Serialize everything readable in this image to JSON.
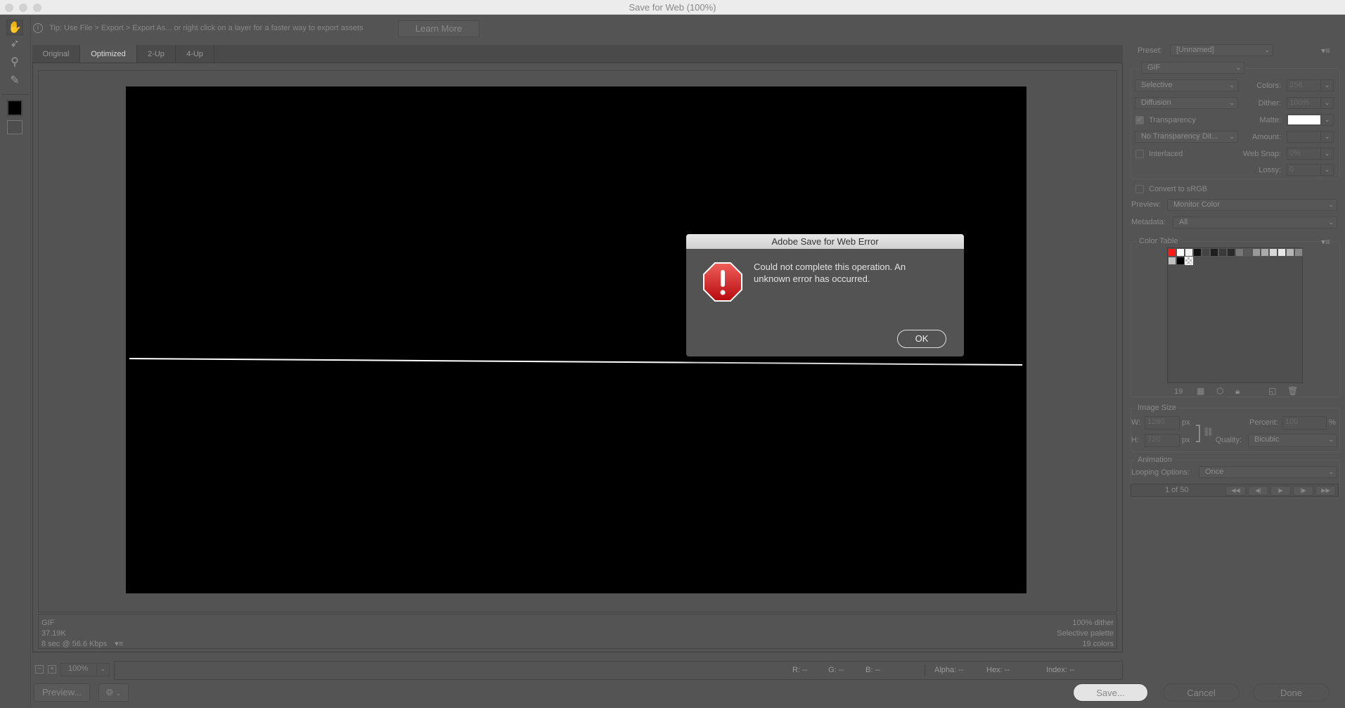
{
  "window": {
    "title": "Save for Web (100%)"
  },
  "tip": {
    "text": "Tip: Use File > Export > Export As...  or right click on a layer for a faster way to export assets",
    "learn_more": "Learn More"
  },
  "tabs": [
    {
      "label": "Original"
    },
    {
      "label": "Optimized",
      "active": true
    },
    {
      "label": "2-Up"
    },
    {
      "label": "4-Up"
    }
  ],
  "info_left": {
    "format": "GIF",
    "size": "37.19K",
    "time": "8 sec @ 56.6 Kbps"
  },
  "info_right": {
    "dither": "100% dither",
    "palette": "Selective palette",
    "colors": "19 colors"
  },
  "zoom": {
    "value": "100%"
  },
  "status": {
    "r": "R: --",
    "g": "G: --",
    "b": "B: --",
    "alpha": "Alpha: --",
    "hex": "Hex: --",
    "index": "Index: --"
  },
  "buttons": {
    "preview": "Preview...",
    "save": "Save...",
    "cancel": "Cancel",
    "done": "Done"
  },
  "settings": {
    "preset_label": "Preset:",
    "preset": "[Unnamed]",
    "format": "GIF",
    "reduction": "Selective",
    "colors_label": "Colors:",
    "colors": "256",
    "dither_algo": "Diffusion",
    "dither_label": "Dither:",
    "dither": "100%",
    "transparency_label": "Transparency",
    "transparency": true,
    "matte_label": "Matte:",
    "matte_color": "#ffffff",
    "trans_dither": "No Transparency Dit...",
    "amount_label": "Amount:",
    "amount": "",
    "interlaced_label": "Interlaced",
    "interlaced": false,
    "websnap_label": "Web Snap:",
    "websnap": "0%",
    "lossy_label": "Lossy:",
    "lossy": "0",
    "srgb_label": "Convert to sRGB",
    "srgb": false,
    "preview_label": "Preview:",
    "preview": "Monitor Color",
    "metadata_label": "Metadata:",
    "metadata": "All"
  },
  "color_table": {
    "title": "Color Table",
    "count": "19",
    "swatches": [
      "#ff1a1a",
      "#ffffff",
      "#f0f0f0",
      "#111111",
      "#444444",
      "#1e1e1e",
      "#3a3a3a",
      "#2a2a2a",
      "#777777",
      "#5a5a5a",
      "#999999",
      "#aaaaaa",
      "#d8d8d8",
      "#e8e8e8",
      "#b5b5b5",
      "#888888",
      "#c0c0c0",
      "#000000",
      "checker"
    ]
  },
  "image_size": {
    "title": "Image Size",
    "w_label": "W:",
    "w": "1280",
    "h_label": "H:",
    "h": "720",
    "unit": "px",
    "percent_label": "Percent:",
    "percent": "100",
    "percent_unit": "%",
    "quality_label": "Quality:",
    "quality": "Bicubic"
  },
  "animation": {
    "title": "Animation",
    "looping_label": "Looping Options:",
    "looping": "Once",
    "frame": "1 of 50"
  },
  "dialog": {
    "title": "Adobe Save for Web Error",
    "message": "Could not complete this operation. An unknown error has occurred.",
    "ok": "OK"
  }
}
